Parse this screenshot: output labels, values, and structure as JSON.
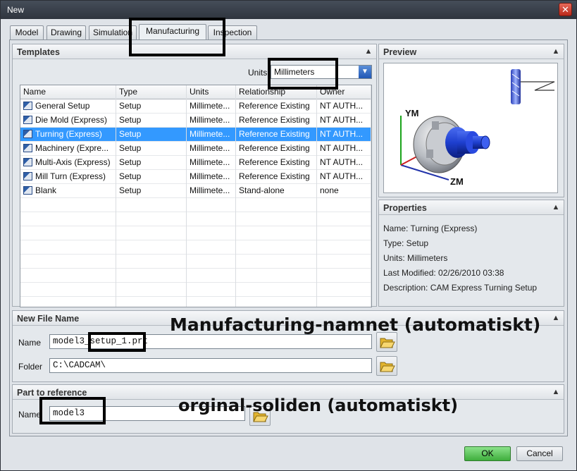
{
  "window": {
    "title": "New",
    "close_glyph": "✕"
  },
  "tabs": [
    {
      "label": "Model",
      "active": false
    },
    {
      "label": "Drawing",
      "active": false
    },
    {
      "label": "Simulation",
      "active": false
    },
    {
      "label": "Manufacturing",
      "active": true
    },
    {
      "label": "Inspection",
      "active": false
    }
  ],
  "templates": {
    "title": "Templates",
    "units_label": "Units",
    "units_value": "Millimeters",
    "columns": [
      "Name",
      "Type",
      "Units",
      "Relationship",
      "Owner"
    ],
    "rows": [
      {
        "name": "General Setup",
        "type": "Setup",
        "units": "Millimete...",
        "relationship": "Reference Existing",
        "owner": "NT AUTH...",
        "selected": false
      },
      {
        "name": "Die Mold (Express)",
        "type": "Setup",
        "units": "Millimete...",
        "relationship": "Reference Existing",
        "owner": "NT AUTH...",
        "selected": false
      },
      {
        "name": "Turning (Express)",
        "type": "Setup",
        "units": "Millimete...",
        "relationship": "Reference Existing",
        "owner": "NT AUTH...",
        "selected": true
      },
      {
        "name": "Machinery (Expre...",
        "type": "Setup",
        "units": "Millimete...",
        "relationship": "Reference Existing",
        "owner": "NT AUTH...",
        "selected": false
      },
      {
        "name": "Multi-Axis (Express)",
        "type": "Setup",
        "units": "Millimete...",
        "relationship": "Reference Existing",
        "owner": "NT AUTH...",
        "selected": false
      },
      {
        "name": "Mill Turn (Express)",
        "type": "Setup",
        "units": "Millimete...",
        "relationship": "Reference Existing",
        "owner": "NT AUTH...",
        "selected": false
      },
      {
        "name": "Blank",
        "type": "Setup",
        "units": "Millimete...",
        "relationship": "Stand-alone",
        "owner": "none",
        "selected": false
      }
    ]
  },
  "preview": {
    "title": "Preview",
    "axis_y": "YM",
    "axis_z": "ZM"
  },
  "properties": {
    "title": "Properties",
    "lines": [
      "Name: Turning (Express)",
      "Type: Setup",
      "Units: Millimeters",
      "Last Modified: 02/26/2010 03:38",
      "Description: CAM Express Turning Setup"
    ]
  },
  "new_file": {
    "title": "New File Name",
    "name_label": "Name",
    "name_value": "model3_setup_1.prt",
    "folder_label": "Folder",
    "folder_value": "C:\\CADCAM\\"
  },
  "part_ref": {
    "title": "Part to reference",
    "name_label": "Name",
    "name_value": "model3"
  },
  "annotations": {
    "manufacturing_name": "Manufacturing-namnet (automatiskt)",
    "original_solid": "orginal-soliden (automatiskt)"
  },
  "buttons": {
    "ok": "OK",
    "cancel": "Cancel"
  },
  "icons": {
    "collapse": "chevron-up-icon",
    "folder": "folder-open-icon",
    "template": "template-file-icon",
    "dropdown": "chevron-down-icon"
  },
  "colors": {
    "selection": "#3399ff",
    "ok_button": "#4cbb4a",
    "accent": "#2057b5"
  }
}
